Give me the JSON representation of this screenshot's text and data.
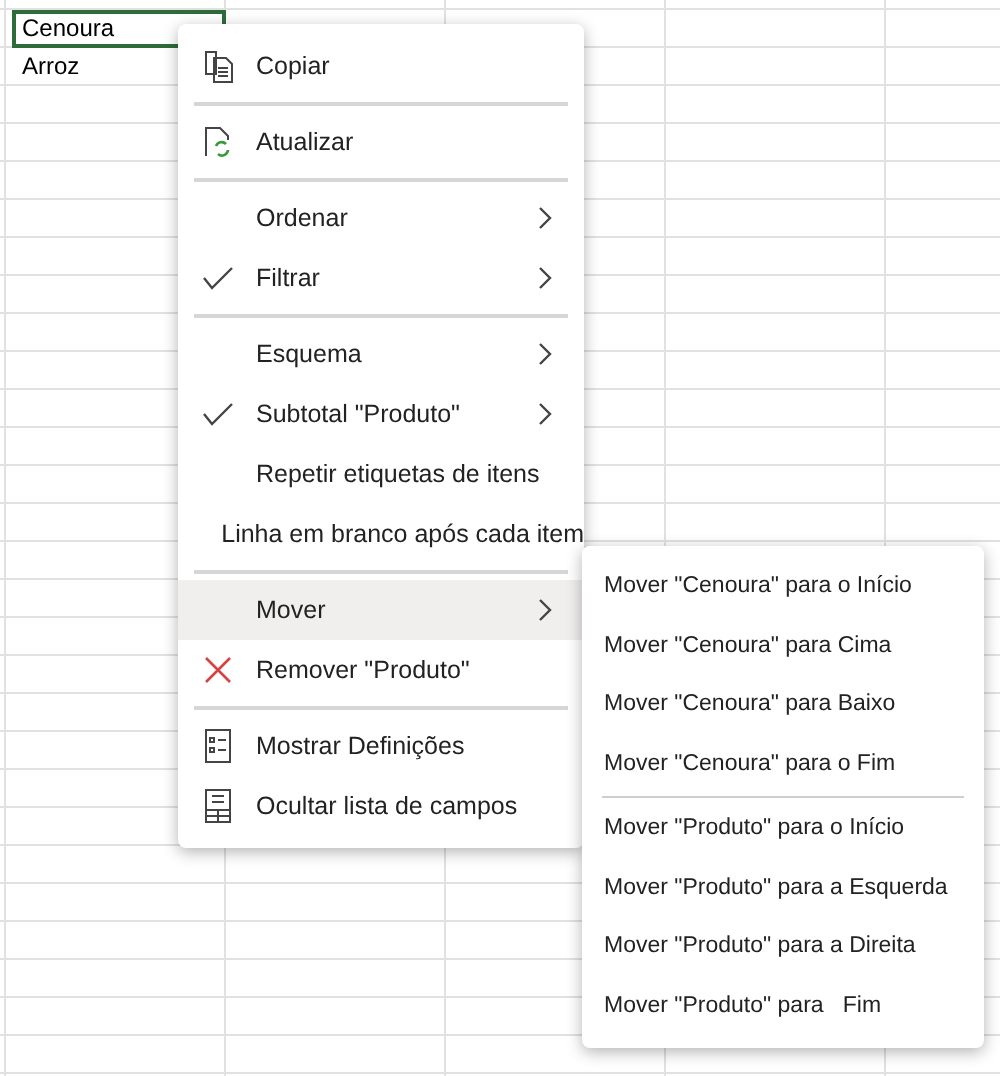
{
  "cells": [
    {
      "text": "Cenoura",
      "selected": true
    },
    {
      "text": "Arroz",
      "selected": false
    }
  ],
  "context_menu": {
    "groups": [
      [
        {
          "label": "Copiar",
          "checked": false,
          "submenu": false,
          "selected": false
        }
      ],
      [
        {
          "label": "Atualizar",
          "checked": false,
          "submenu": false,
          "selected": false
        }
      ],
      [
        {
          "label": "Ordenar",
          "checked": false,
          "submenu": true,
          "selected": false
        },
        {
          "label": "Filtrar",
          "checked": true,
          "submenu": true,
          "selected": false
        }
      ],
      [
        {
          "label": "Esquema",
          "checked": false,
          "submenu": true,
          "selected": false
        },
        {
          "label": "Subtotal \"Produto\"",
          "checked": true,
          "submenu": true,
          "selected": false
        },
        {
          "label": "Repetir etiquetas de itens",
          "checked": false,
          "submenu": false,
          "selected": false
        },
        {
          "label": "Linha em branco após cada item",
          "checked": false,
          "submenu": false,
          "selected": false
        }
      ],
      [
        {
          "label": "Mover",
          "checked": false,
          "submenu": true,
          "selected": true
        },
        {
          "label": "Remover \"Produto\"",
          "checked": false,
          "submenu": false,
          "selected": false
        }
      ],
      [
        {
          "label": "Mostrar Definições",
          "checked": false,
          "submenu": false,
          "selected": false
        },
        {
          "label": "Ocultar lista de campos",
          "checked": false,
          "submenu": false,
          "selected": false
        }
      ]
    ]
  },
  "submenu": {
    "groups": [
      [
        "Mover \"Cenoura\" para o Início",
        "Mover \"Cenoura\" para Cima",
        "Mover \"Cenoura\" para Baixo",
        "Mover \"Cenoura\" para o Fim"
      ],
      [
        "Mover \"Produto\" para o Início",
        "Mover \"Produto\" para a Esquerda",
        "Mover \"Produto\" para a Direita",
        "Mover \"Produto\" para   Fim"
      ]
    ]
  }
}
